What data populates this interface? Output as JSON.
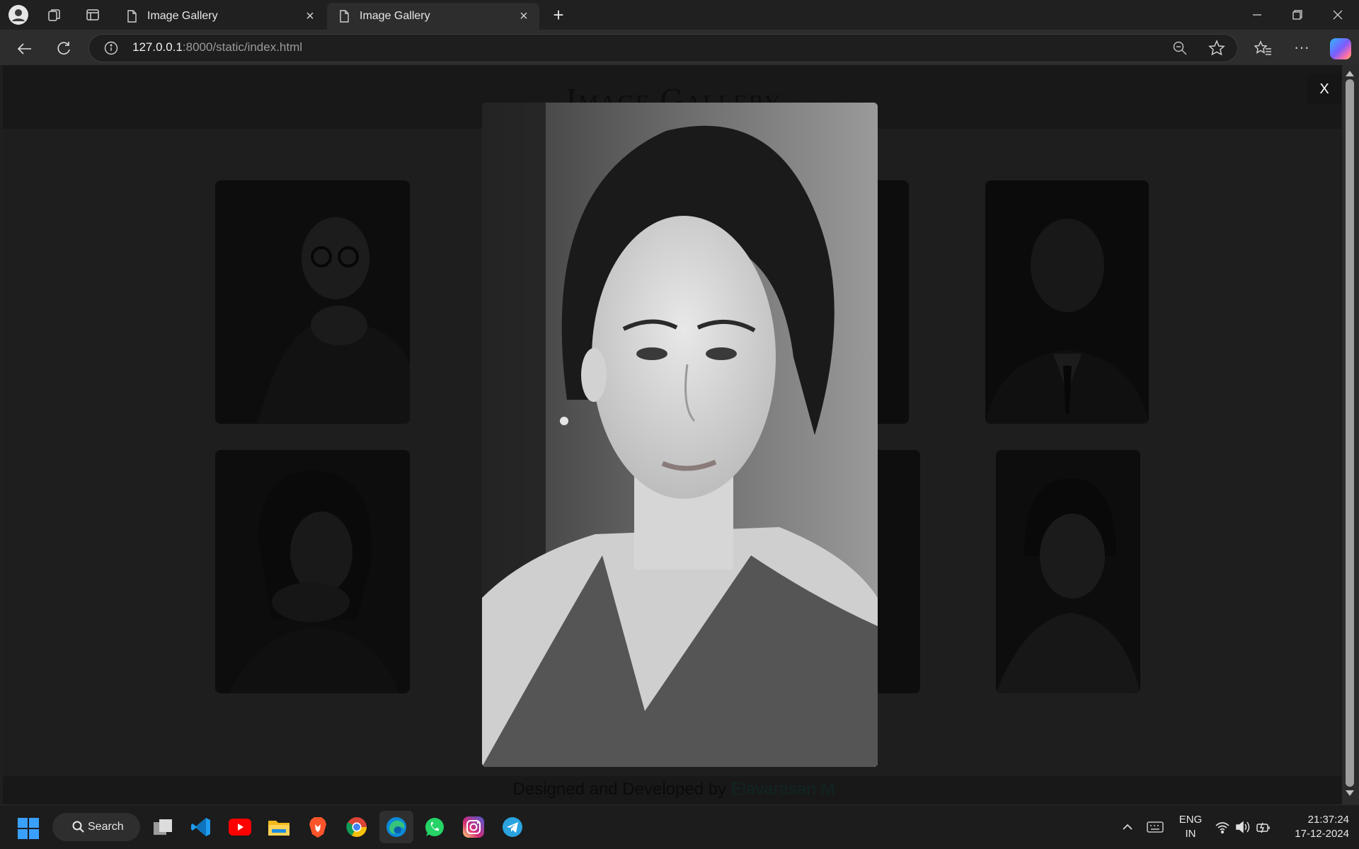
{
  "browser": {
    "tabs": [
      {
        "title": "Image Gallery"
      },
      {
        "title": "Image Gallery"
      }
    ],
    "address": {
      "host": "127.0.0.1",
      "path": ":8000/static/index.html"
    }
  },
  "page": {
    "title": "Image Gallery",
    "close_label": "X",
    "footer": {
      "prefix": "Designed and Developed by ",
      "author": "Elavarasan M"
    }
  },
  "taskbar": {
    "search_label": "Search",
    "language": "ENG",
    "region": "IN",
    "time": "21:37:24",
    "date": "17-12-2024"
  },
  "colors": {
    "accent_footer_name": "#1a3a36",
    "browser_bg": "#202020",
    "page_bg": "#2e2e2e"
  }
}
